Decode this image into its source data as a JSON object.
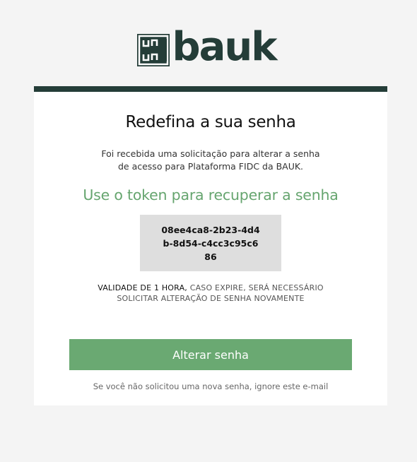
{
  "logo": {
    "wordmark": "bauk"
  },
  "email": {
    "title": "Redefina a sua senha",
    "description_line1": "Foi recebida uma solicitação para alterar a senha",
    "description_line2": "de acesso para Plataforma FIDC da BAUK.",
    "subtitle": "Use o token para recuperar a senha",
    "token": "08ee4ca8-2b23-4d4b-8d54-c4cc3c95c686",
    "validity_strong": "VALIDADE DE 1 HORA,",
    "validity_rest": " CASO EXPIRE, SERÁ NECESSÁRIO",
    "validity_line2": "SOLICITAR ALTERAÇÃO DE SENHA NOVAMENTE",
    "button_label": "Alterar senha",
    "footer": "Se você não solicitou uma nova senha, ignore este e-mail"
  },
  "colors": {
    "brand_dark": "#243d38",
    "accent_green": "#6aa972",
    "background": "#f4f4f4",
    "token_box": "#dedede"
  }
}
